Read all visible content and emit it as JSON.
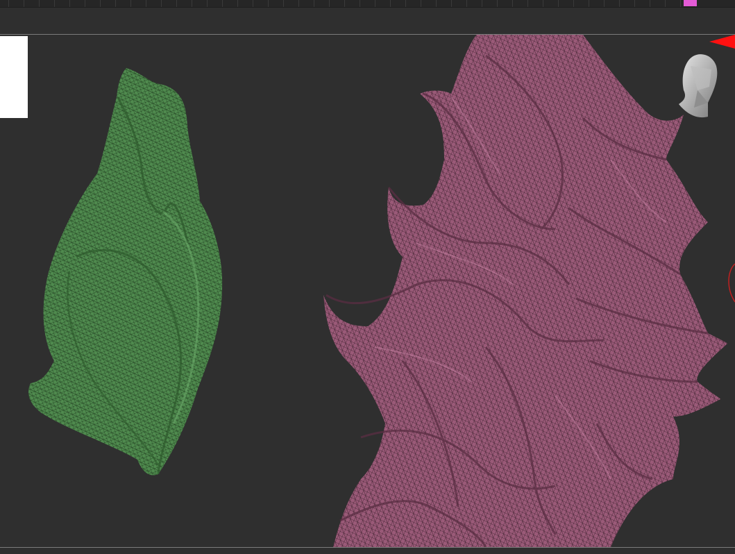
{
  "app": {
    "accent_color": "#e45bd6",
    "viewport_bg": "#2f2f2f"
  },
  "scene": {
    "objects": [
      {
        "name": "green-leaf-subtool",
        "color": "#4f8a4e",
        "wireframe": true
      },
      {
        "name": "pink-hair-subtool",
        "color": "#9a5a78",
        "wireframe": true
      }
    ]
  },
  "navigator": {
    "icon": "head-orientation-icon",
    "axis_icon": "x-axis-arrow-icon",
    "rotate_icon": "rotate-ring-icon"
  }
}
